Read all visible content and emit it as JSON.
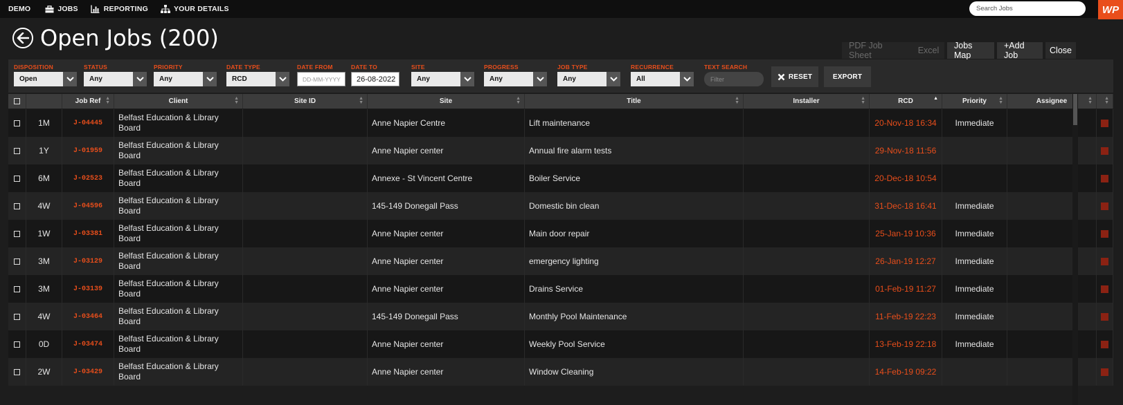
{
  "nav": {
    "demo": "DEMO",
    "jobs": "JOBS",
    "reporting": "REPORTING",
    "your_details": "YOUR DETAILS",
    "search_placeholder": "Search Jobs",
    "logo": "WP"
  },
  "page": {
    "title": "Open Jobs (200)",
    "actions": [
      "PDF Job Sheet",
      "Excel",
      "Jobs Map",
      "+Add Job",
      "Close"
    ]
  },
  "filters": {
    "disposition": {
      "label": "DISPOSITION",
      "value": "Open"
    },
    "status": {
      "label": "STATUS",
      "value": "Any"
    },
    "priority": {
      "label": "PRIORITY",
      "value": "Any"
    },
    "date_type": {
      "label": "DATE TYPE",
      "value": "RCD"
    },
    "date_from": {
      "label": "DATE FROM",
      "placeholder": "DD-MM-YYYY"
    },
    "date_to": {
      "label": "DATE TO",
      "value": "26-08-2022"
    },
    "site": {
      "label": "SITE",
      "value": "Any"
    },
    "progress": {
      "label": "PROGRESS",
      "value": "Any"
    },
    "job_type": {
      "label": "JOB TYPE",
      "value": "Any"
    },
    "recurrence": {
      "label": "RECURRENCE",
      "value": "All"
    },
    "text_search": {
      "label": "TEXT SEARCH",
      "placeholder": "Filter"
    },
    "reset": "RESET",
    "export": "EXPORT"
  },
  "table": {
    "columns": [
      "",
      "",
      "Job Ref",
      "Client",
      "Site ID",
      "Site",
      "Title",
      "Installer",
      "RCD",
      "Priority",
      "Assignee",
      ""
    ],
    "rows": [
      {
        "age": "1M",
        "ref": "J-04445",
        "client1": "Belfast Education & Library",
        "client2": "Board",
        "site_id": "",
        "site": "Anne Napier Centre",
        "title": "Lift maintenance",
        "installer": "",
        "rcd": "20-Nov-18 16:34",
        "priority": "Immediate",
        "assignee": ""
      },
      {
        "age": "1Y",
        "ref": "J-01959",
        "client1": "Belfast Education & Library",
        "client2": "Board",
        "site_id": "",
        "site": "Anne Napier center",
        "title": "Annual fire alarm tests",
        "installer": "",
        "rcd": "29-Nov-18 11:56",
        "priority": "",
        "assignee": ""
      },
      {
        "age": "6M",
        "ref": "J-02523",
        "client1": "Belfast Education & Library",
        "client2": "Board",
        "site_id": "",
        "site": "Annexe - St Vincent Centre",
        "title": "Boiler Service",
        "installer": "",
        "rcd": "20-Dec-18 10:54",
        "priority": "",
        "assignee": ""
      },
      {
        "age": "4W",
        "ref": "J-04596",
        "client1": "Belfast Education & Library",
        "client2": "Board",
        "site_id": "",
        "site": "145-149 Donegall Pass",
        "title": "Domestic bin clean",
        "installer": "",
        "rcd": "31-Dec-18 16:41",
        "priority": "Immediate",
        "assignee": ""
      },
      {
        "age": "1W",
        "ref": "J-03381",
        "client1": "Belfast Education & Library",
        "client2": "Board",
        "site_id": "",
        "site": "Anne Napier center",
        "title": "Main door repair",
        "installer": "",
        "rcd": "25-Jan-19 10:36",
        "priority": "Immediate",
        "assignee": ""
      },
      {
        "age": "3M",
        "ref": "J-03129",
        "client1": "Belfast Education & Library",
        "client2": "Board",
        "site_id": "",
        "site": "Anne Napier center",
        "title": "emergency lighting",
        "installer": "",
        "rcd": "26-Jan-19 12:27",
        "priority": "Immediate",
        "assignee": ""
      },
      {
        "age": "3M",
        "ref": "J-03139",
        "client1": "Belfast Education & Library",
        "client2": "Board",
        "site_id": "",
        "site": "Anne Napier center",
        "title": "Drains Service",
        "installer": "",
        "rcd": "01-Feb-19 11:27",
        "priority": "Immediate",
        "assignee": ""
      },
      {
        "age": "4W",
        "ref": "J-03464",
        "client1": "Belfast Education & Library",
        "client2": "Board",
        "site_id": "",
        "site": "145-149 Donegall Pass",
        "title": "Monthly Pool Maintenance",
        "installer": "",
        "rcd": "11-Feb-19 22:23",
        "priority": "Immediate",
        "assignee": ""
      },
      {
        "age": "0D",
        "ref": "J-03474",
        "client1": "Belfast Education & Library",
        "client2": "Board",
        "site_id": "",
        "site": "Anne Napier center",
        "title": "Weekly Pool Service",
        "installer": "",
        "rcd": "13-Feb-19 22:18",
        "priority": "Immediate",
        "assignee": ""
      },
      {
        "age": "2W",
        "ref": "J-03429",
        "client1": "Belfast Education & Library",
        "client2": "Board",
        "site_id": "",
        "site": "Anne Napier center",
        "title": "Window Cleaning",
        "installer": "",
        "rcd": "14-Feb-19 09:22",
        "priority": "",
        "assignee": ""
      }
    ]
  },
  "colors": {
    "accent": "#e94e1b",
    "background": "#1d1d1d",
    "flag": "#8b2213"
  }
}
